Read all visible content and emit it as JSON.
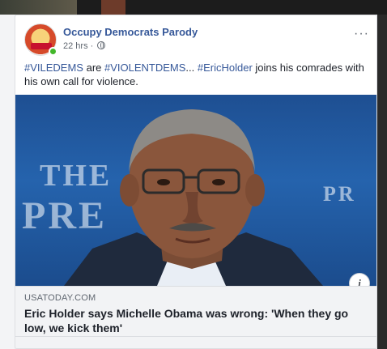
{
  "post": {
    "page_name": "Occupy Democrats Parody",
    "time": "22 hrs",
    "dot": "·",
    "more_icon": "···",
    "text_parts": [
      {
        "text": "#VILEDEMS",
        "tag": true
      },
      {
        "text": " are ",
        "tag": false
      },
      {
        "text": "#VIOLENTDEMS",
        "tag": true
      },
      {
        "text": "... ",
        "tag": false
      },
      {
        "text": "#EricHolder",
        "tag": true
      },
      {
        "text": " joins his comrades with his own call for violence.",
        "tag": false
      }
    ]
  },
  "link": {
    "domain": "USATODAY.COM",
    "headline": "Eric Holder says Michelle Obama was wrong: 'When they go low, we kick them'",
    "info_icon": "i"
  },
  "colors": {
    "link_blue": "#365899",
    "online_green": "#42b72a",
    "photo_bg": "#2563ad"
  }
}
